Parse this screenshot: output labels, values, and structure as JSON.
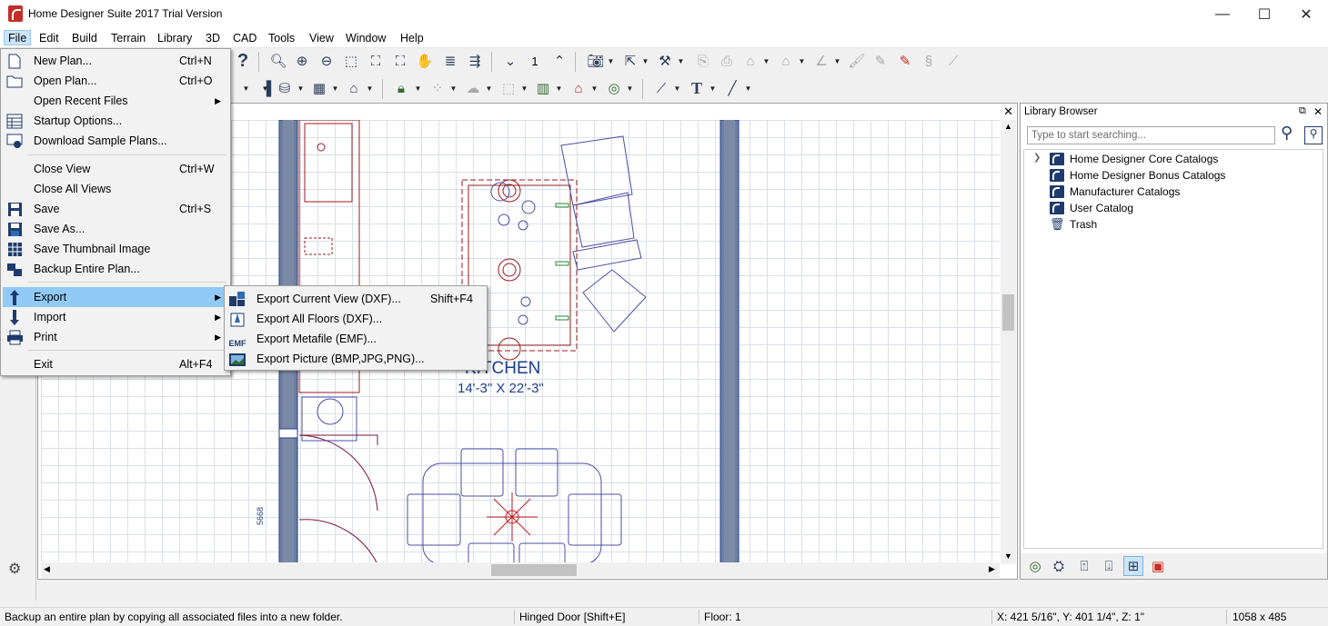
{
  "window": {
    "title": "Home Designer Suite 2017 Trial Version",
    "minimize": "—",
    "maximize": "☐",
    "close": "✕"
  },
  "menubar": [
    "File",
    "Edit",
    "Build",
    "Terrain",
    "Library",
    "3D",
    "CAD",
    "Tools",
    "View",
    "Window",
    "Help"
  ],
  "toolbar": {
    "floor_value": "1"
  },
  "file_menu": {
    "items": [
      {
        "label": "New Plan...",
        "shortcut": "Ctrl+N"
      },
      {
        "label": "Open Plan...",
        "shortcut": "Ctrl+O"
      },
      {
        "label": "Open Recent Files",
        "shortcut": ""
      },
      {
        "label": "Startup Options...",
        "shortcut": ""
      },
      {
        "label": "Download Sample Plans...",
        "shortcut": ""
      },
      {
        "label": "Close View",
        "shortcut": "Ctrl+W"
      },
      {
        "label": "Close All Views",
        "shortcut": ""
      },
      {
        "label": "Save",
        "shortcut": "Ctrl+S"
      },
      {
        "label": "Save As...",
        "shortcut": ""
      },
      {
        "label": "Save Thumbnail Image",
        "shortcut": ""
      },
      {
        "label": "Backup Entire Plan...",
        "shortcut": ""
      },
      {
        "label": "Export",
        "shortcut": ""
      },
      {
        "label": "Import",
        "shortcut": ""
      },
      {
        "label": "Print",
        "shortcut": ""
      },
      {
        "label": "Exit",
        "shortcut": "Alt+F4"
      }
    ]
  },
  "export_menu": {
    "items": [
      {
        "label": "Export Current View (DXF)...",
        "shortcut": "Shift+F4"
      },
      {
        "label": "Export All Floors (DXF)...",
        "shortcut": ""
      },
      {
        "label": "Export Metafile (EMF)...",
        "shortcut": ""
      },
      {
        "label": "Export Picture (BMP,JPG,PNG)...",
        "shortcut": ""
      }
    ],
    "emf_icon_text": "EMF"
  },
  "plan": {
    "room_name": "KITCHEN",
    "room_dims": "14'-3\" X 22'-3\"",
    "door_tag": "5668"
  },
  "library": {
    "title": "Library Browser",
    "search_placeholder": "Type to start searching...",
    "items": [
      "Home Designer Core Catalogs",
      "Home Designer Bonus Catalogs",
      "Manufacturer Catalogs",
      "User Catalog",
      "Trash"
    ]
  },
  "status": {
    "message": "Backup an entire plan by copying all associated files into a new folder.",
    "tool": "Hinged Door [Shift+E]",
    "floor": "Floor: 1",
    "coords": "X: 421 5/16\", Y: 401 1/4\", Z: 1\"",
    "size": "1058 x 485"
  },
  "colors": {
    "accent_red": "#c62d24",
    "menu_highlight": "#91c9f7",
    "plan_blue": "#1c3d8f",
    "plan_red": "#9b1b1b",
    "plan_furniture": "#4b4fa6"
  }
}
